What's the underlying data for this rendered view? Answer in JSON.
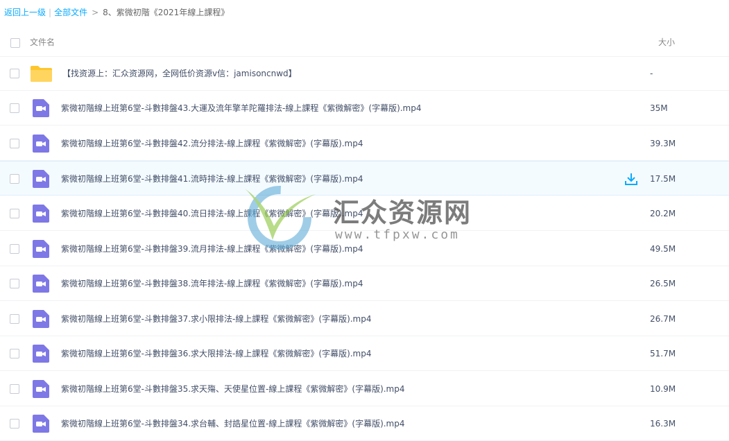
{
  "breadcrumb": {
    "back_label": "返回上一级",
    "separator": "|",
    "all_files_label": "全部文件",
    "arrow": ">",
    "current_folder": "8、紫微初階《2021年線上課程》"
  },
  "header": {
    "name_column": "文件名",
    "size_column": "大小"
  },
  "colors": {
    "link": "#09aaff",
    "folder": "#ffc62c",
    "video_icon": "#7e78e6",
    "download": "#09aaff",
    "hover_row": "#f4fbff"
  },
  "files": [
    {
      "icon": "folder-icon",
      "name": "【找资源上：汇众资源网，全网低价资源v信：jamisoncnwd】",
      "size": "-"
    },
    {
      "icon": "video-icon",
      "name": "紫微初階線上班第6堂-斗數排盤43.大運及流年擎羊陀羅排法-線上課程《紫微解密》(字幕版).mp4",
      "size": "35M"
    },
    {
      "icon": "video-icon",
      "name": "紫微初階線上班第6堂-斗數排盤42.流分排法-線上課程《紫微解密》(字幕版).mp4",
      "size": "39.3M"
    },
    {
      "icon": "video-icon",
      "name": "紫微初階線上班第6堂-斗數排盤41.流時排法-線上課程《紫微解密》(字幕版).mp4",
      "size": "17.5M"
    },
    {
      "icon": "video-icon",
      "name": "紫微初階線上班第6堂-斗數排盤40.流日排法-線上課程《紫微解密》(字幕版).mp4",
      "size": "20.2M"
    },
    {
      "icon": "video-icon",
      "name": "紫微初階線上班第6堂-斗數排盤39.流月排法-線上課程《紫微解密》(字幕版).mp4",
      "size": "49.5M"
    },
    {
      "icon": "video-icon",
      "name": "紫微初階線上班第6堂-斗數排盤38.流年排法-線上課程《紫微解密》(字幕版).mp4",
      "size": "26.5M"
    },
    {
      "icon": "video-icon",
      "name": "紫微初階線上班第6堂-斗數排盤37.求小限排法-線上課程《紫微解密》(字幕版).mp4",
      "size": "26.7M"
    },
    {
      "icon": "video-icon",
      "name": "紫微初階線上班第6堂-斗數排盤36.求大限排法-線上課程《紫微解密》(字幕版).mp4",
      "size": "51.7M"
    },
    {
      "icon": "video-icon",
      "name": "紫微初階線上班第6堂-斗數排盤35.求天殤、天使星位置-線上課程《紫微解密》(字幕版).mp4",
      "size": "10.9M"
    },
    {
      "icon": "video-icon",
      "name": "紫微初階線上班第6堂-斗數排盤34.求台輔、封誥星位置-線上課程《紫微解密》(字幕版).mp4",
      "size": "16.3M"
    }
  ],
  "watermark": {
    "title": "汇众资源网",
    "url": "www.tfpxw.com"
  }
}
